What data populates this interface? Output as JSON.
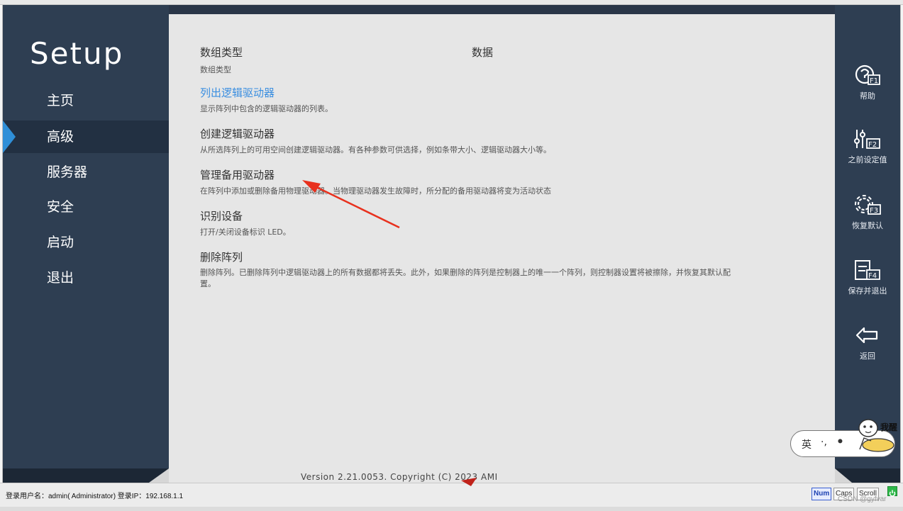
{
  "sidebar": {
    "logo": "Setup",
    "items": [
      {
        "label": "主页",
        "active": false
      },
      {
        "label": "高级",
        "active": true
      },
      {
        "label": "服务器",
        "active": false
      },
      {
        "label": "安全",
        "active": false
      },
      {
        "label": "启动",
        "active": false
      },
      {
        "label": "退出",
        "active": false
      }
    ]
  },
  "main": {
    "header_left": "数组类型",
    "header_right": "数据",
    "header_sub": "数组类型",
    "items": [
      {
        "title": "列出逻辑驱动器",
        "desc": "显示阵列中包含的逻辑驱动器的列表。",
        "highlighted": true
      },
      {
        "title": "创建逻辑驱动器",
        "desc": "从所选阵列上的可用空间创建逻辑驱动器。有各种参数可供选择，例如条带大小、逻辑驱动器大小等。"
      },
      {
        "title": "管理备用驱动器",
        "desc": "在阵列中添加或删除备用物理驱动器。当物理驱动器发生故障时，所分配的备用驱动器将变为活动状态"
      },
      {
        "title": "识别设备",
        "desc": "打开/关闭设备标识 LED。"
      },
      {
        "title": "删除阵列",
        "desc": "删除阵列。已删除阵列中逻辑驱动器上的所有数据都将丢失。此外，如果删除的阵列是控制器上的唯一一个阵列，则控制器设置将被擦除，并恢复其默认配置。"
      }
    ],
    "version": "Version 2.21.0053. Copyright (C) 2023 AMI"
  },
  "right_panel": {
    "buttons": [
      {
        "label": "帮助",
        "icon": "help-f1-icon"
      },
      {
        "label": "之前设定值",
        "icon": "sliders-f2-icon"
      },
      {
        "label": "恢复默认",
        "icon": "gear-f3-icon"
      },
      {
        "label": "保存并退出",
        "icon": "save-exit-f4-icon"
      },
      {
        "label": "返回",
        "icon": "back-arrow-icon"
      }
    ]
  },
  "statusbar": {
    "login_text": "登录用户名：admin( Administrator)   登录IP：192.168.1.1",
    "keys": [
      {
        "label": "Num",
        "on": true
      },
      {
        "label": "Caps",
        "on": false
      },
      {
        "label": "Scroll",
        "on": false
      }
    ],
    "watermark": "CSDN @gyfvar"
  },
  "ime": {
    "lang": "英",
    "punct": "·,",
    "tag": "我醒"
  },
  "colors": {
    "sidebar_bg": "#2e3e52",
    "active_indicator": "#2f8fd8",
    "link_blue": "#3a8ee0",
    "annotation_red": "#e8311e"
  }
}
